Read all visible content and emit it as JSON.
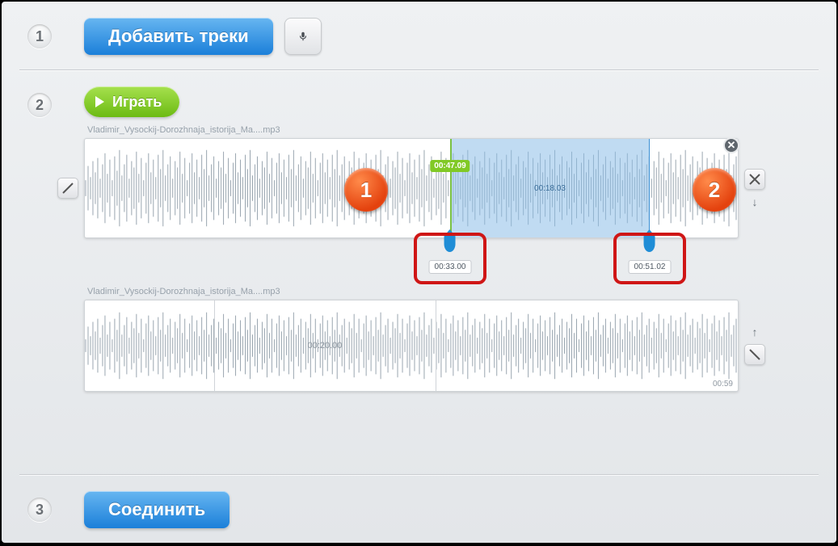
{
  "step_numbers": {
    "one": "1",
    "two": "2",
    "three": "3"
  },
  "buttons": {
    "add_tracks": "Добавить треки",
    "play": "Играть",
    "join": "Соединить"
  },
  "callouts": {
    "badge1": "1",
    "badge2": "2"
  },
  "track1": {
    "filename": "Vladimir_Vysockij-Dorozhnaja_istorija_Ma....mp3",
    "playhead_time": "00:47.09",
    "selection_duration": "00:18.03",
    "handle_start": "00:33.00",
    "handle_end": "00:51.02"
  },
  "track2": {
    "filename": "Vladimir_Vysockij-Dorozhnaja_istorija_Ma....mp3",
    "center_duration": "00:20.00",
    "total_time": "00:59"
  }
}
